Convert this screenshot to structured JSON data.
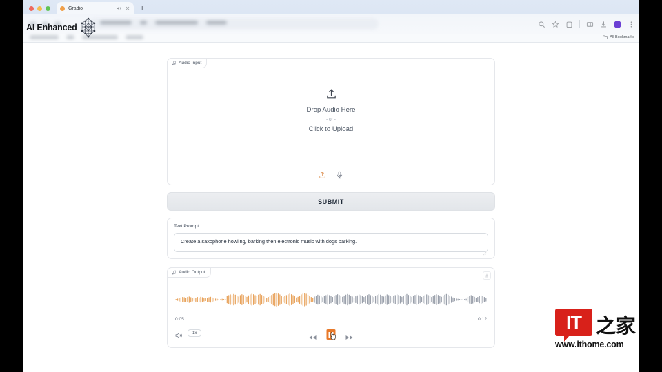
{
  "browser": {
    "tab": {
      "title": "Gradio",
      "favicon": "gradio-favicon",
      "audio_icon": "speaker-playing-icon",
      "close_icon": "close-icon"
    },
    "new_tab_label": "+",
    "toolbar_icons": [
      "zoom-search-icon",
      "bookmark-star-icon",
      "extensions-icon",
      "split-screen-icon",
      "downloads-icon",
      "profile-avatar",
      "chrome-menu-icon"
    ],
    "bookmarks_bar": {
      "all_bookmarks_label": "All Bookmarks",
      "folder_icon": "folder-icon"
    }
  },
  "overlay": {
    "title": "AI Enhanced",
    "graphic": "neural-network-molecule-icon"
  },
  "app": {
    "audio_input": {
      "label": "Audio Input",
      "label_icon": "music-note-icon",
      "upload_icon": "upload-arrow-icon",
      "drop_text": "Drop Audio Here",
      "or_text": "- or -",
      "click_text": "Click to Upload",
      "toolbar_icons": [
        "upload-file-icon",
        "microphone-icon"
      ]
    },
    "submit": {
      "label": "SUBMIT"
    },
    "prompt": {
      "label": "Text Prompt",
      "value": "Create a saxophone howling, barking then electronic music with dogs barking.",
      "placeholder": "Text Prompt"
    },
    "audio_output": {
      "label": "Audio Output",
      "label_icon": "music-note-icon",
      "download_icon": "download-icon",
      "current_time": "0:05",
      "total_time": "0:12",
      "volume_icon": "volume-speaker-icon",
      "speed_label": "1x",
      "rewind_icon": "rewind-icon",
      "pause_icon": "pause-icon",
      "forward_icon": "fast-forward-icon",
      "played_color": "#e8a35c",
      "unplayed_color": "#9aa0ab",
      "accent_color": "#e8792a",
      "progress_ratio": 0.415
    }
  },
  "watermark": {
    "logo_text": "IT",
    "cn_text": "之家",
    "url": "www.ithome.com",
    "logo_color": "#d8211a"
  },
  "waveform": {
    "played": [
      3,
      5,
      8,
      10,
      12,
      11,
      9,
      12,
      14,
      11,
      8,
      6,
      9,
      12,
      10,
      13,
      11,
      8,
      6,
      9,
      11,
      13,
      10,
      8,
      5,
      4,
      3,
      2,
      4,
      3,
      2,
      16,
      20,
      23,
      21,
      25,
      22,
      18,
      14,
      20,
      24,
      21,
      17,
      13,
      19,
      23,
      26,
      24,
      20,
      16,
      22,
      25,
      21,
      18,
      14,
      9,
      12,
      16,
      21,
      25,
      28,
      30,
      27,
      23,
      18,
      13,
      16,
      20,
      24,
      27,
      24,
      20,
      15,
      10,
      13,
      18,
      23,
      27,
      29,
      26,
      22,
      17,
      12,
      9
    ],
    "unplayed": [
      14,
      18,
      22,
      19,
      15,
      11,
      16,
      20,
      23,
      20,
      16,
      12,
      17,
      21,
      24,
      21,
      17,
      13,
      18,
      22,
      25,
      22,
      18,
      14,
      10,
      15,
      19,
      23,
      20,
      16,
      12,
      17,
      21,
      24,
      20,
      16,
      12,
      17,
      21,
      25,
      22,
      18,
      14,
      19,
      23,
      20,
      16,
      12,
      16,
      20,
      24,
      21,
      17,
      13,
      18,
      22,
      25,
      21,
      17,
      13,
      17,
      21,
      24,
      20,
      16,
      12,
      16,
      20,
      23,
      20,
      16,
      12,
      17,
      21,
      24,
      21,
      17,
      13,
      18,
      22,
      25,
      22,
      18,
      14,
      10,
      7,
      5,
      4,
      3,
      2,
      2,
      3,
      4,
      13,
      17,
      20,
      17,
      13,
      9,
      12,
      16,
      19,
      16,
      12,
      8
    ]
  }
}
